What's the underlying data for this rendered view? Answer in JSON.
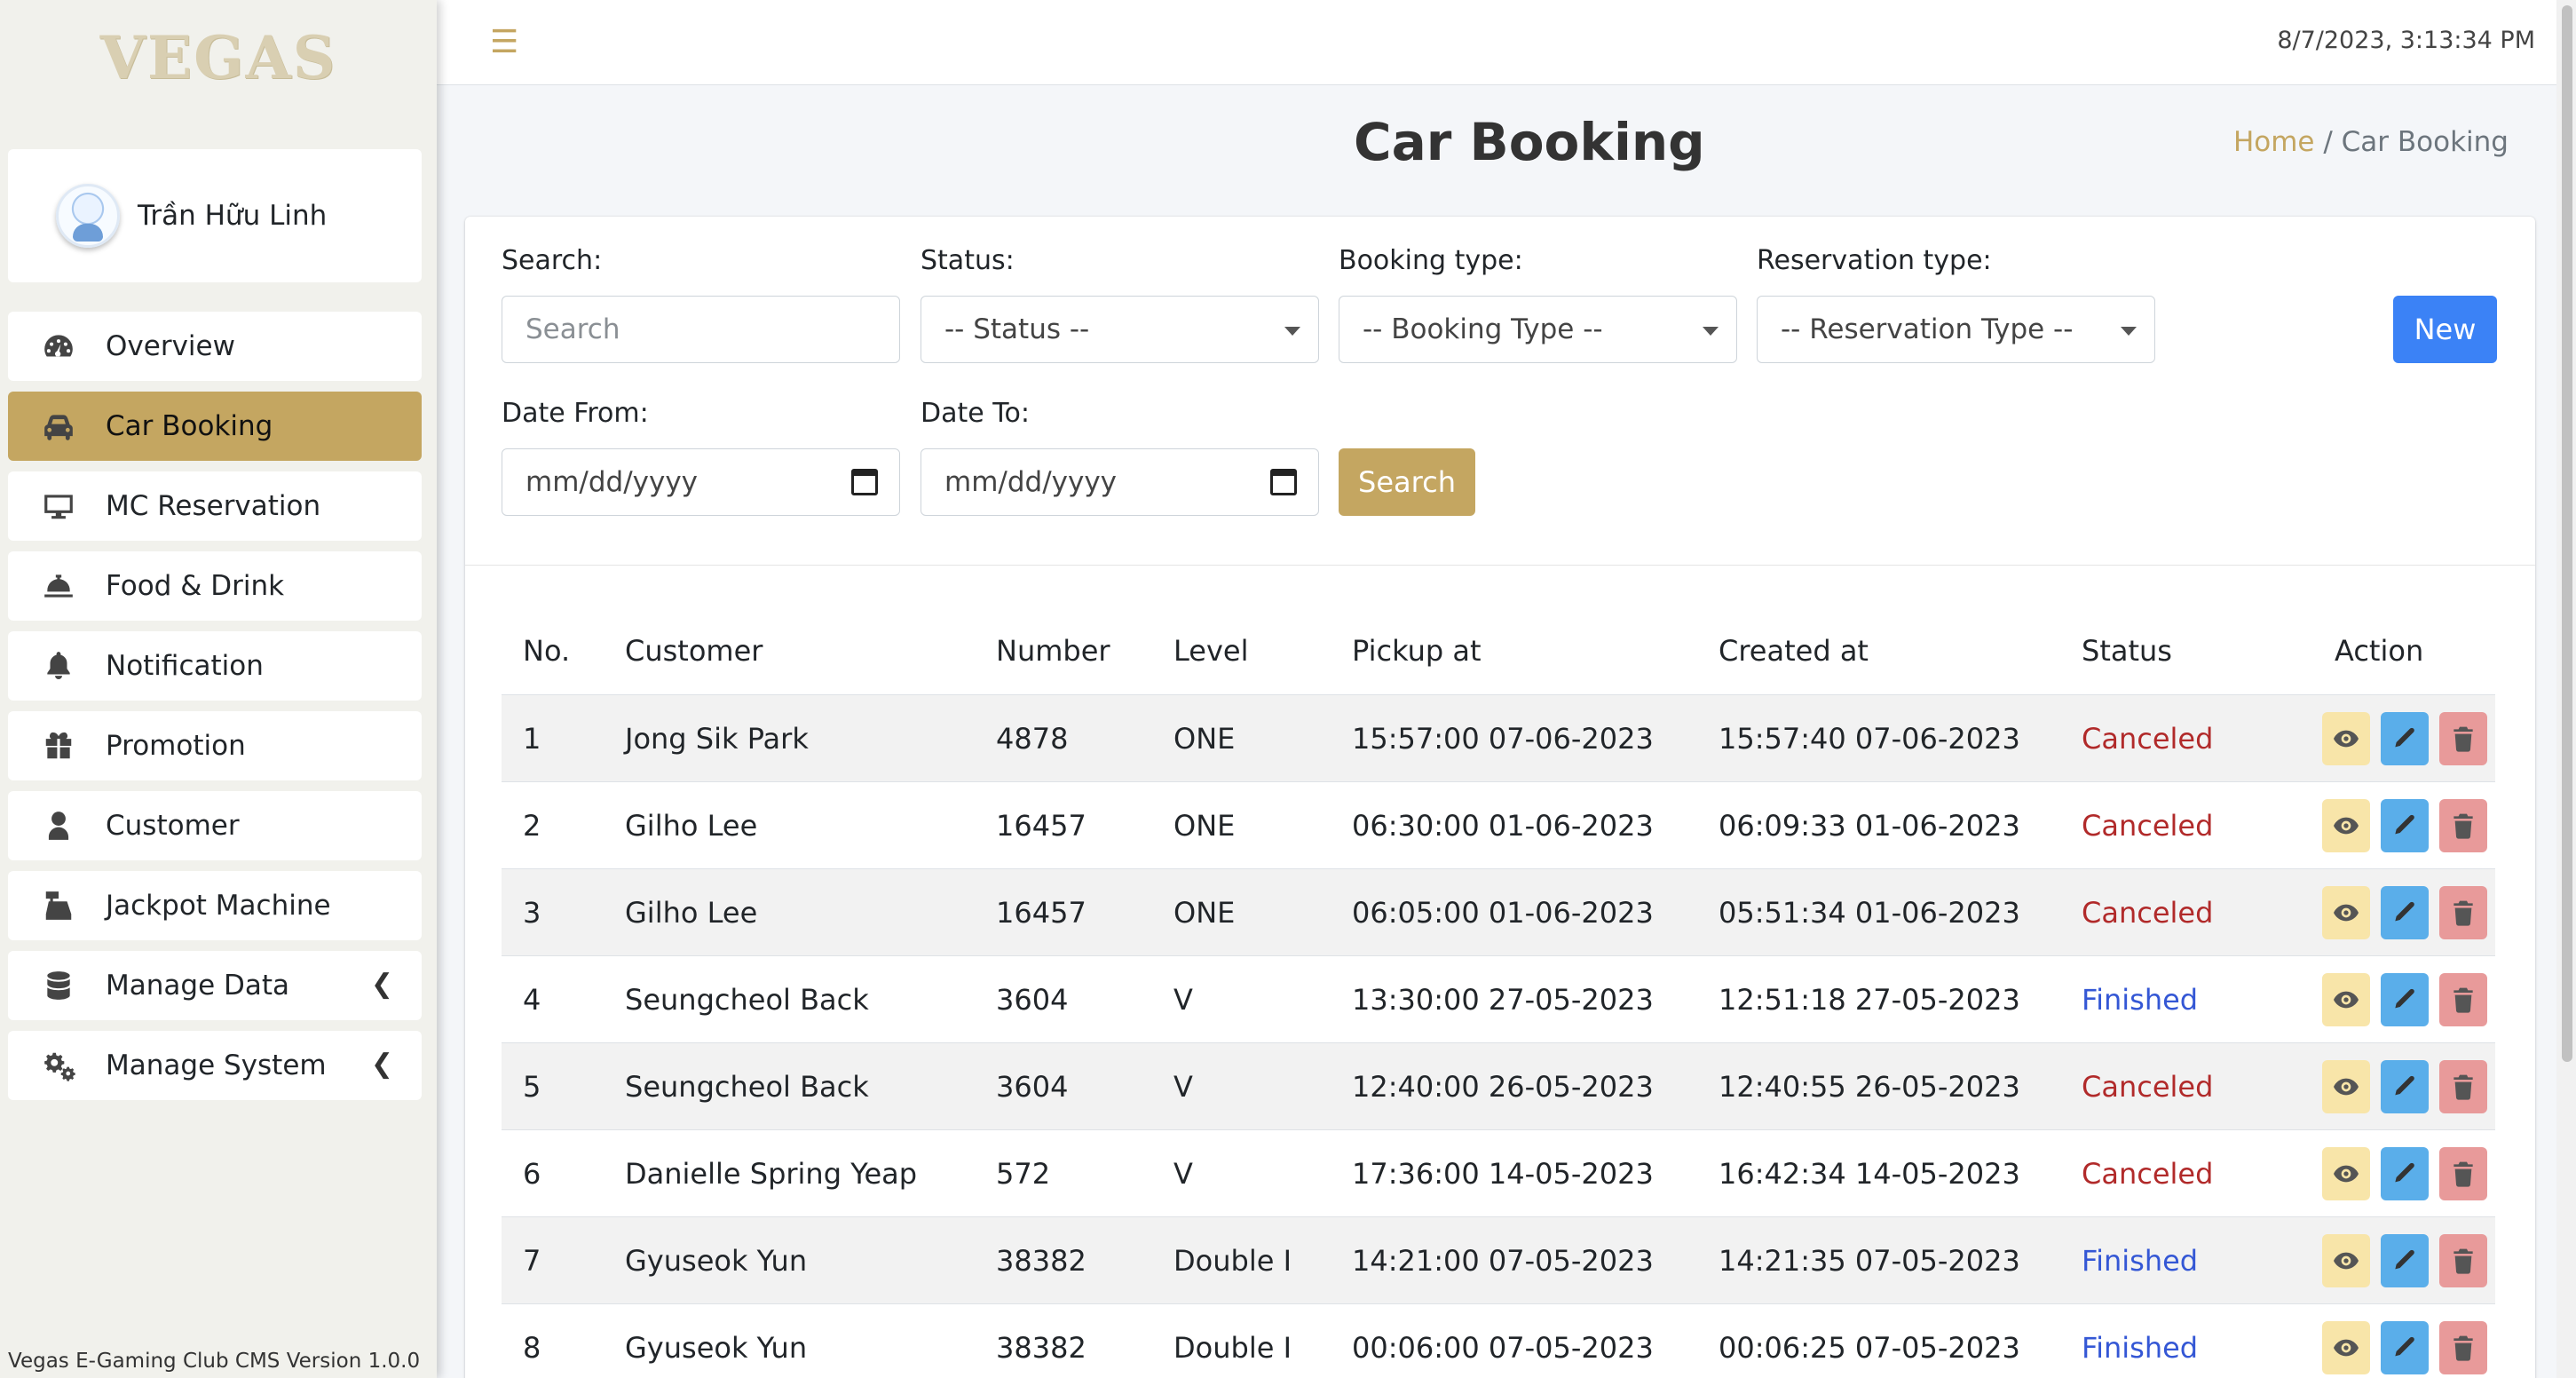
{
  "app": {
    "logo": "VEGAS",
    "version": "Vegas E-Gaming Club CMS Version 1.0.0"
  },
  "user": {
    "name": "Trần Hữu Linh"
  },
  "sidebar": {
    "items": [
      {
        "label": "Overview",
        "icon": "dashboard-icon"
      },
      {
        "label": "Car Booking",
        "icon": "car-icon"
      },
      {
        "label": "MC Reservation",
        "icon": "monitor-icon"
      },
      {
        "label": "Food & Drink",
        "icon": "bell-concierge-icon"
      },
      {
        "label": "Notification",
        "icon": "bell-icon"
      },
      {
        "label": "Promotion",
        "icon": "gift-icon"
      },
      {
        "label": "Customer",
        "icon": "user-icon"
      },
      {
        "label": "Jackpot Machine",
        "icon": "cash-register-icon"
      },
      {
        "label": "Manage Data",
        "icon": "database-icon"
      },
      {
        "label": "Manage System",
        "icon": "gears-icon"
      }
    ],
    "active": "Car Booking"
  },
  "header": {
    "datetime": "8/7/2023, 3:13:34 PM"
  },
  "page": {
    "title": "Car Booking",
    "breadcrumb": {
      "home": "Home",
      "separator": "/",
      "current": "Car Booking"
    }
  },
  "filters": {
    "search_label": "Search:",
    "search_placeholder": "Search",
    "status_label": "Status:",
    "status_value": "-- Status --",
    "booking_type_label": "Booking type:",
    "booking_type_value": "-- Booking Type --",
    "reservation_type_label": "Reservation type:",
    "reservation_type_value": "-- Reservation Type --",
    "new_button": "New",
    "date_from_label": "Date From:",
    "date_from_placeholder": "mm/dd/yyyy",
    "date_to_label": "Date To:",
    "date_to_placeholder": "mm/dd/yyyy",
    "search_button": "Search"
  },
  "table": {
    "columns": [
      "No.",
      "Customer",
      "Number",
      "Level",
      "Pickup at",
      "Created at",
      "Status",
      "Action"
    ],
    "rows": [
      {
        "no": "1",
        "customer": "Jong Sik Park",
        "number": "4878",
        "level": "ONE",
        "pickup": "15:57:00 07-06-2023",
        "created": "15:57:40 07-06-2023",
        "status": "Canceled"
      },
      {
        "no": "2",
        "customer": "Gilho Lee",
        "number": "16457",
        "level": "ONE",
        "pickup": "06:30:00 01-06-2023",
        "created": "06:09:33 01-06-2023",
        "status": "Canceled"
      },
      {
        "no": "3",
        "customer": "Gilho Lee",
        "number": "16457",
        "level": "ONE",
        "pickup": "06:05:00 01-06-2023",
        "created": "05:51:34 01-06-2023",
        "status": "Canceled"
      },
      {
        "no": "4",
        "customer": "Seungcheol Back",
        "number": "3604",
        "level": "V",
        "pickup": "13:30:00 27-05-2023",
        "created": "12:51:18 27-05-2023",
        "status": "Finished"
      },
      {
        "no": "5",
        "customer": "Seungcheol Back",
        "number": "3604",
        "level": "V",
        "pickup": "12:40:00 26-05-2023",
        "created": "12:40:55 26-05-2023",
        "status": "Canceled"
      },
      {
        "no": "6",
        "customer": "Danielle Spring Yeap",
        "number": "572",
        "level": "V",
        "pickup": "17:36:00 14-05-2023",
        "created": "16:42:34 14-05-2023",
        "status": "Canceled"
      },
      {
        "no": "7",
        "customer": "Gyuseok Yun",
        "number": "38382",
        "level": "Double I",
        "pickup": "14:21:00 07-05-2023",
        "created": "14:21:35 07-05-2023",
        "status": "Finished"
      },
      {
        "no": "8",
        "customer": "Gyuseok Yun",
        "number": "38382",
        "level": "Double I",
        "pickup": "00:06:00 07-05-2023",
        "created": "00:06:25 07-05-2023",
        "status": "Finished"
      }
    ]
  },
  "colors": {
    "accent": "#c4a661",
    "primary": "#3b82f6",
    "canceled": "#b12a2a",
    "finished": "#3457d5"
  }
}
